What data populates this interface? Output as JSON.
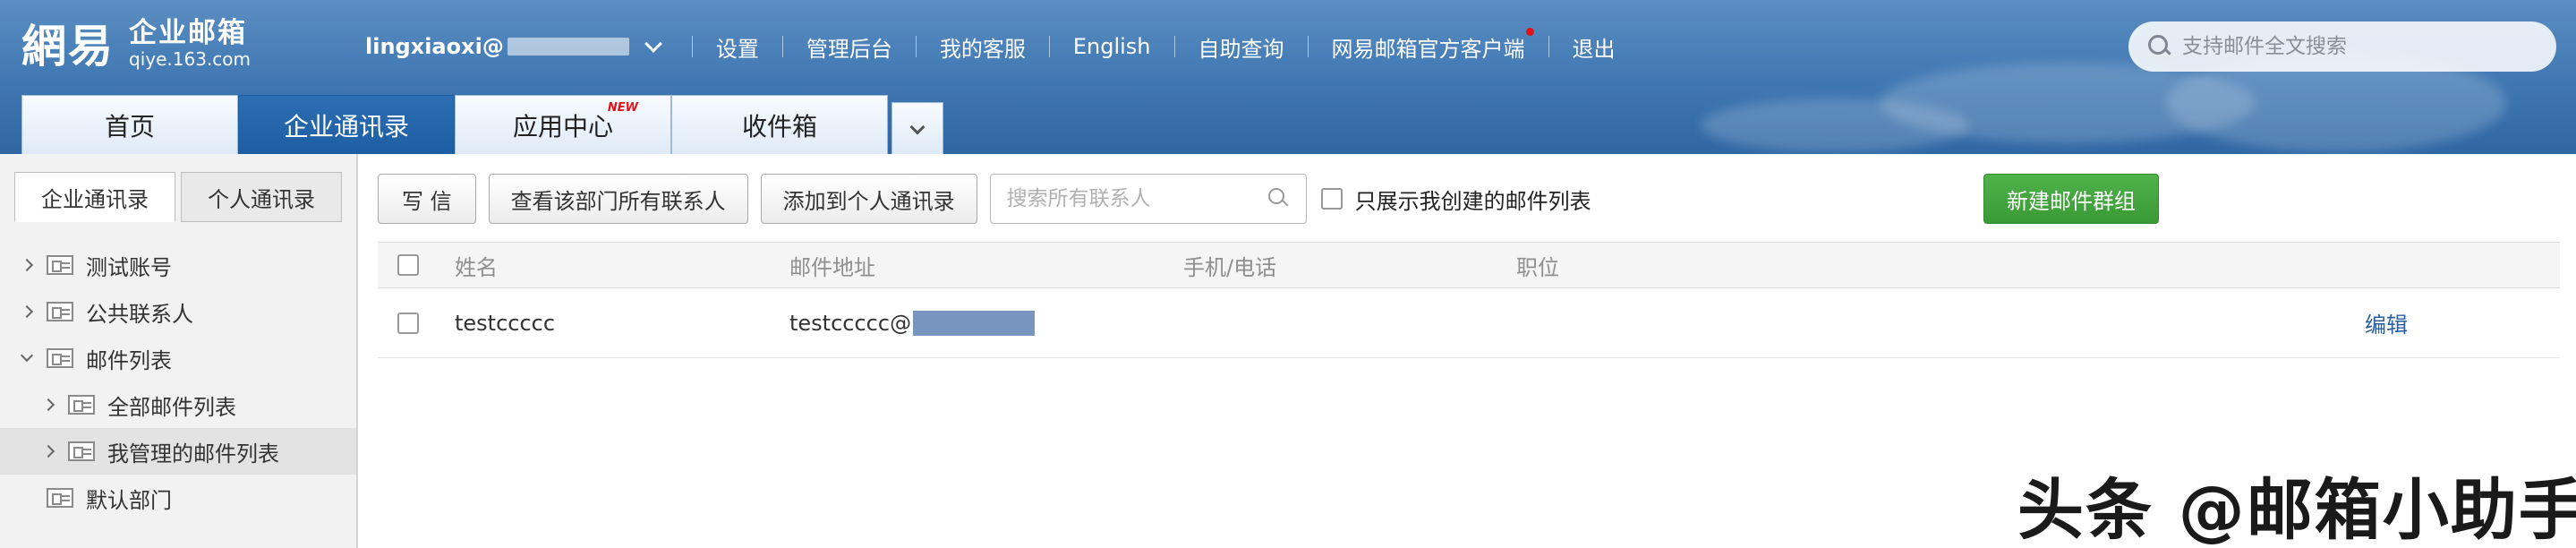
{
  "header": {
    "logo_mark": "網易",
    "logo_title": "企业邮箱",
    "logo_sub": "qiye.163.com",
    "user_name": "lingxiaoxi@",
    "nav_links": [
      "设置",
      "管理后台",
      "我的客服",
      "English",
      "自助查询",
      "网易邮箱官方客户端",
      "退出"
    ],
    "search_placeholder": "支持邮件全文搜索"
  },
  "main_tabs": [
    {
      "label": "首页",
      "active": false
    },
    {
      "label": "企业通讯录",
      "active": true
    },
    {
      "label": "应用中心",
      "active": false,
      "badge": "NEW"
    },
    {
      "label": "收件箱",
      "active": false
    }
  ],
  "sidebar": {
    "tabs": [
      {
        "label": "企业通讯录",
        "active": true
      },
      {
        "label": "个人通讯录",
        "active": false
      }
    ],
    "tree": [
      {
        "label": "测试账号",
        "expanded": false,
        "level": 0
      },
      {
        "label": "公共联系人",
        "expanded": false,
        "level": 0
      },
      {
        "label": "邮件列表",
        "expanded": true,
        "level": 0
      },
      {
        "label": "全部邮件列表",
        "expanded": false,
        "level": 1
      },
      {
        "label": "我管理的邮件列表",
        "expanded": false,
        "level": 1,
        "selected": true
      },
      {
        "label": "默认部门",
        "expanded": null,
        "level": 0
      }
    ]
  },
  "toolbar": {
    "write_label": "写 信",
    "view_all_label": "查看该部门所有联系人",
    "add_personal_label": "添加到个人通讯录",
    "search_placeholder": "搜索所有联系人",
    "only_mine_label": "只展示我创建的邮件列表",
    "new_group_label": "新建邮件群组"
  },
  "table": {
    "headers": {
      "name": "姓名",
      "email": "邮件地址",
      "phone": "手机/电话",
      "title": "职位"
    },
    "rows": [
      {
        "name": "testccccc",
        "email": "testccccc@",
        "phone": "",
        "title": "",
        "action": "编辑"
      }
    ]
  },
  "watermark": "头条 @邮箱小助手",
  "colors": {
    "header_blue": "#3f77b2",
    "active_tab": "#1d5ea3",
    "green_button": "#3a9a36",
    "link_blue": "#2a5f9e",
    "new_badge_red": "#e4131a"
  }
}
